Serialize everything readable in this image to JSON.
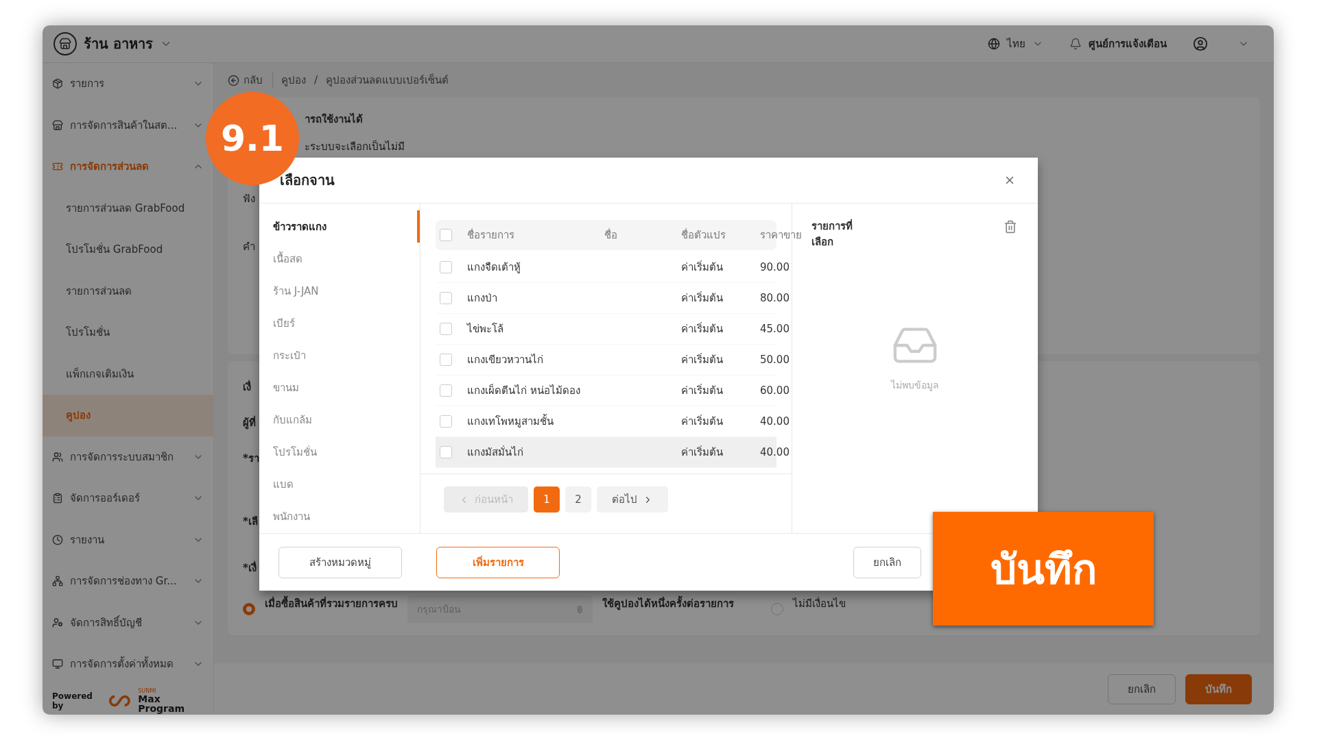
{
  "header": {
    "store_name": "ร้าน อาหาร",
    "language": "ไทย",
    "notifications": "ศูนย์การแจ้งเตือน"
  },
  "sidebar": {
    "items": [
      {
        "label": "รายการ",
        "expanded": false,
        "selected": false
      },
      {
        "label": "การจัดการสินค้าในสต...",
        "expanded": false,
        "selected": false
      },
      {
        "label": "การจัดการส่วนลด",
        "expanded": true,
        "selected": true,
        "children": [
          {
            "label": "รายการส่วนลด GrabFood",
            "selected": false
          },
          {
            "label": "โปรโมชั่น GrabFood",
            "selected": false
          },
          {
            "label": "รายการส่วนลด",
            "selected": false
          },
          {
            "label": "โปรโมชั่น",
            "selected": false
          },
          {
            "label": "แพ็กเกจเติมเงิน",
            "selected": false
          },
          {
            "label": "คูปอง",
            "selected": true
          }
        ]
      },
      {
        "label": "การจัดการระบบสมาชิก",
        "expanded": false,
        "selected": false
      },
      {
        "label": "จัดการออร์เดอร์",
        "expanded": false,
        "selected": false
      },
      {
        "label": "รายงาน",
        "expanded": false,
        "selected": false
      },
      {
        "label": "การจัดการช่องทาง Gr...",
        "expanded": false,
        "selected": false
      },
      {
        "label": "จัดการสิทธิ์บัญชี",
        "expanded": false,
        "selected": false
      },
      {
        "label": "การจัดการตั้งค่าทั้งหมด",
        "expanded": false,
        "selected": false
      }
    ],
    "powered_by": "Powered by",
    "brand_small": "SUNMI",
    "brand": "Max Program"
  },
  "breadcrumb": {
    "back": "กลับ",
    "items": [
      "คูปอง",
      "คูปองส่วนลดแบบเปอร์เซ็นต์"
    ],
    "separator": "/"
  },
  "background_form": {
    "top_texts": [
      "ารถใช้งานได้",
      "ะระบบจะเลือกเป็นไม่มี"
    ],
    "left_fragments": [
      "ฟัง",
      "คำ"
    ],
    "section_fragments": [
      "เงื่",
      "ผู้ที่",
      "*รา",
      "*เลื",
      "*เงื่"
    ],
    "condition_option": {
      "label": "เมื่อซื้อสินค้าที่รวมรายการครบ",
      "selected": true
    },
    "amount_field": {
      "placeholder": "กรุณาป้อน",
      "unit": "฿"
    },
    "note": "ใช้คูปองได้หนึ่งครั้งต่อรายการ",
    "no_condition_option": {
      "label": "ไม่มีเงื่อนไข",
      "selected": false
    },
    "buttons": [
      {
        "label": "ยกเลิก",
        "kind": "secondary"
      },
      {
        "label": "บันทึก",
        "kind": "primary"
      }
    ]
  },
  "modal": {
    "title": "เลือกจาน",
    "categories": [
      {
        "label": "ข้าวราดแกง",
        "selected": true
      },
      {
        "label": "เนื้อสด",
        "selected": false
      },
      {
        "label": "ร้าน J-JAN",
        "selected": false
      },
      {
        "label": "เบียร์",
        "selected": false
      },
      {
        "label": "กระเป๋า",
        "selected": false
      },
      {
        "label": "ขานม",
        "selected": false
      },
      {
        "label": "กับแกล้ม",
        "selected": false
      },
      {
        "label": "โปรโมชั่น",
        "selected": false
      },
      {
        "label": "แบด",
        "selected": false
      },
      {
        "label": "พนักงาน",
        "selected": false
      }
    ],
    "table": {
      "columns": [
        "ชื่อรายการ",
        "ชื่อ",
        "ชื่อตัวแปร",
        "ราคาขาย"
      ],
      "all_checked": false,
      "rows": [
        {
          "name": "แกงจืดเต้าหู้",
          "variant": "ค่าเริ่มต้น",
          "price": "90.00",
          "checked": false,
          "highlighted": false
        },
        {
          "name": "แกงป่า",
          "variant": "ค่าเริ่มต้น",
          "price": "80.00",
          "checked": false,
          "highlighted": false
        },
        {
          "name": "ไข่พะโล้",
          "variant": "ค่าเริ่มต้น",
          "price": "45.00",
          "checked": false,
          "highlighted": false
        },
        {
          "name": "แกงเขียวหวานไก่",
          "variant": "ค่าเริ่มต้น",
          "price": "50.00",
          "checked": false,
          "highlighted": false
        },
        {
          "name": "แกงเผ็ดตีนไก่ หน่อไม้ดอง",
          "variant": "ค่าเริ่มต้น",
          "price": "60.00",
          "checked": false,
          "highlighted": false
        },
        {
          "name": "แกงเทโพหมูสามชั้น",
          "variant": "ค่าเริ่มต้น",
          "price": "40.00",
          "checked": false,
          "highlighted": false
        },
        {
          "name": "แกงมัสมั่นไก่",
          "variant": "ค่าเริ่มต้น",
          "price": "40.00",
          "checked": false,
          "highlighted": true
        }
      ]
    },
    "pagination": {
      "prev": {
        "label": "ก่อนหน้า",
        "disabled": true
      },
      "pages": [
        {
          "label": "1",
          "selected": true
        },
        {
          "label": "2",
          "selected": false
        }
      ],
      "next": {
        "label": "ต่อไป",
        "disabled": false
      }
    },
    "selected_panel": {
      "title": "รายการที่เลือก",
      "empty": "ไม่พบข้อมูล"
    },
    "buttons": [
      {
        "label": "สร้างหมวดหมู่",
        "kind": "default"
      },
      {
        "label": "เพิ่มรายการ",
        "kind": "outline"
      },
      {
        "label": "ยกเลิก",
        "kind": "default"
      }
    ]
  },
  "callouts": {
    "step": "9.1",
    "action": "บันทึก"
  }
}
